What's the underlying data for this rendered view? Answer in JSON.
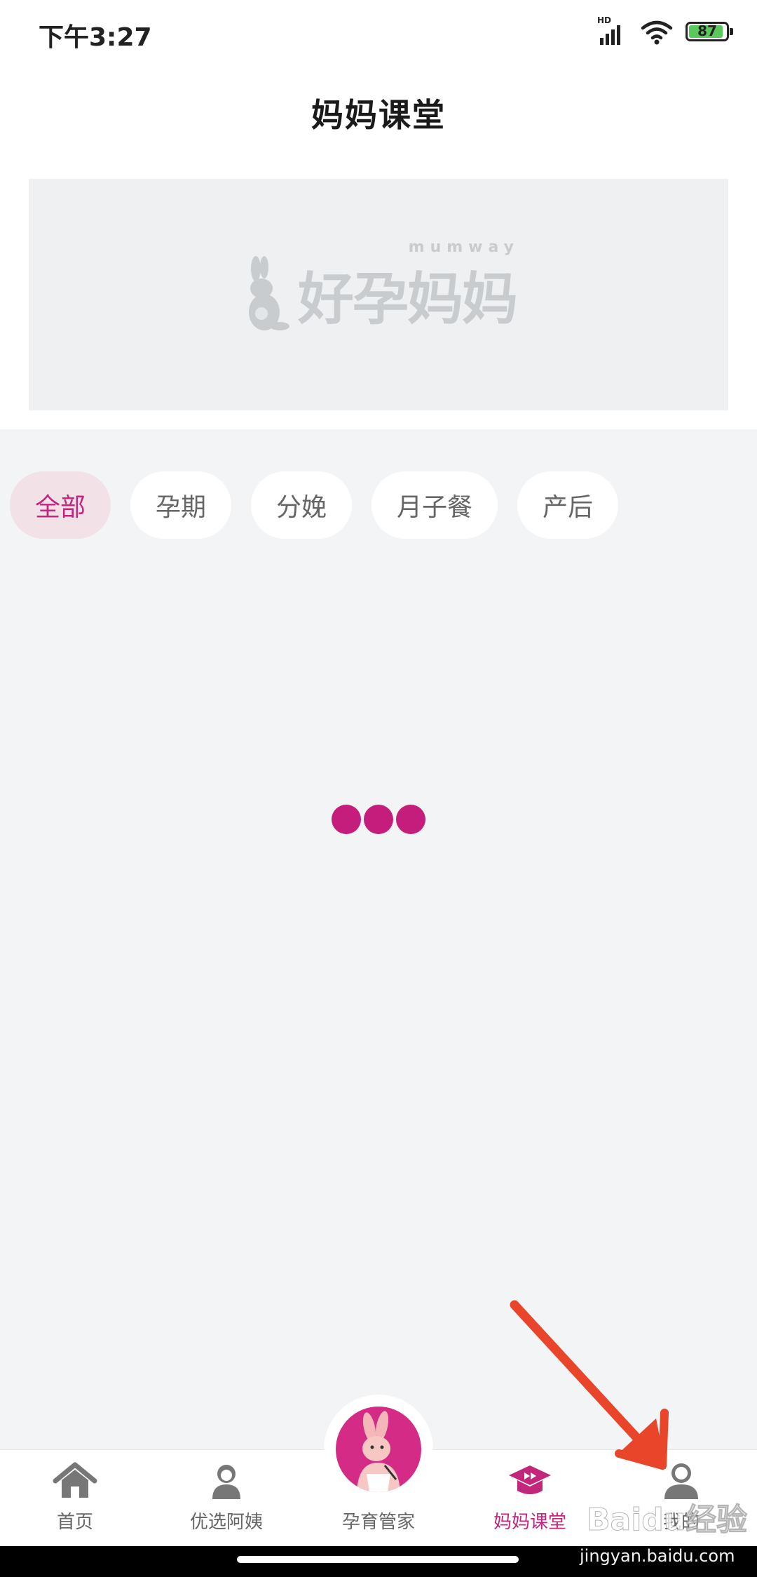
{
  "status_bar": {
    "time": "下午3:27",
    "network_badge": "HD",
    "battery_level": "87"
  },
  "header": {
    "title": "妈妈课堂"
  },
  "banner": {
    "logo_text": "好孕妈妈",
    "logo_subtext": "mumway"
  },
  "category_tabs": [
    {
      "label": "全部",
      "active": true
    },
    {
      "label": "孕期",
      "active": false
    },
    {
      "label": "分娩",
      "active": false
    },
    {
      "label": "月子餐",
      "active": false
    },
    {
      "label": "产后",
      "active": false
    }
  ],
  "bottom_nav": [
    {
      "label": "首页",
      "icon": "home-icon"
    },
    {
      "label": "优选阿姨",
      "icon": "nanny-icon"
    },
    {
      "label": "孕育管家",
      "icon": "kangaroo-mascot-icon"
    },
    {
      "label": "妈妈课堂",
      "icon": "graduation-cap-icon",
      "active": true
    },
    {
      "label": "我的",
      "icon": "user-icon"
    }
  ],
  "watermark": {
    "brand": "Baidu经验",
    "site": "jingyan.baidu.com"
  },
  "colors": {
    "accent": "#c2277c",
    "loader": "#c51d7c",
    "background": "#f2f4f6",
    "arrow": "#e8452a"
  }
}
